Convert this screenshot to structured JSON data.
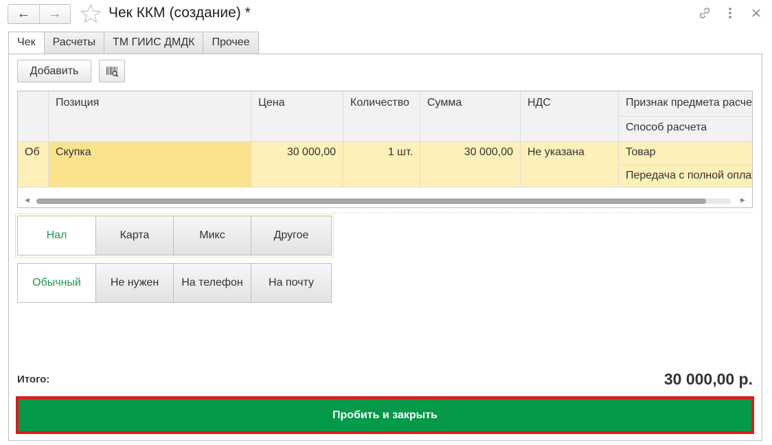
{
  "window": {
    "title": "Чек ККМ (создание) *",
    "icons": {
      "back": "arrow-left-icon",
      "forward": "arrow-right-icon",
      "favorite": "star-icon",
      "link": "link-icon",
      "more": "more-vertical-icon",
      "close": "close-icon"
    }
  },
  "tabs": [
    {
      "label": "Чек",
      "active": true
    },
    {
      "label": "Расчеты",
      "active": false
    },
    {
      "label": "ТМ ГИИС ДМДК",
      "active": false
    },
    {
      "label": "Прочее",
      "active": false
    }
  ],
  "toolbar": {
    "add_label": "Добавить",
    "barcode_icon": "barcode-search-icon"
  },
  "table": {
    "headers": {
      "position": "Позиция",
      "price": "Цена",
      "quantity": "Количество",
      "sum": "Сумма",
      "vat": "НДС",
      "subject_sign": "Признак предмета расчета",
      "payment_method": "Способ расчета"
    },
    "rows": [
      {
        "mark": "Об",
        "position": "Скупка",
        "price": "30 000,00",
        "quantity": "1 шт.",
        "sum": "30 000,00",
        "vat": "Не указана",
        "subject_sign": "Товар",
        "payment_method": "Передача с полной оплатой"
      }
    ]
  },
  "payment_type": {
    "options": [
      "Нал",
      "Карта",
      "Микс",
      "Другое"
    ],
    "selected": "Нал"
  },
  "receipt_delivery": {
    "options": [
      "Обычный",
      "Не нужен",
      "На телефон",
      "На почту"
    ],
    "selected": "Обычный"
  },
  "footer": {
    "total_label": "Итого:",
    "total_value": "30 000,00 р.",
    "submit_label": "Пробить и закрыть"
  },
  "colors": {
    "accent_green": "#05994a",
    "selected_text": "#1b9a48",
    "highlight_row": "#fdf0b8",
    "submit_border": "#e01a1a"
  }
}
